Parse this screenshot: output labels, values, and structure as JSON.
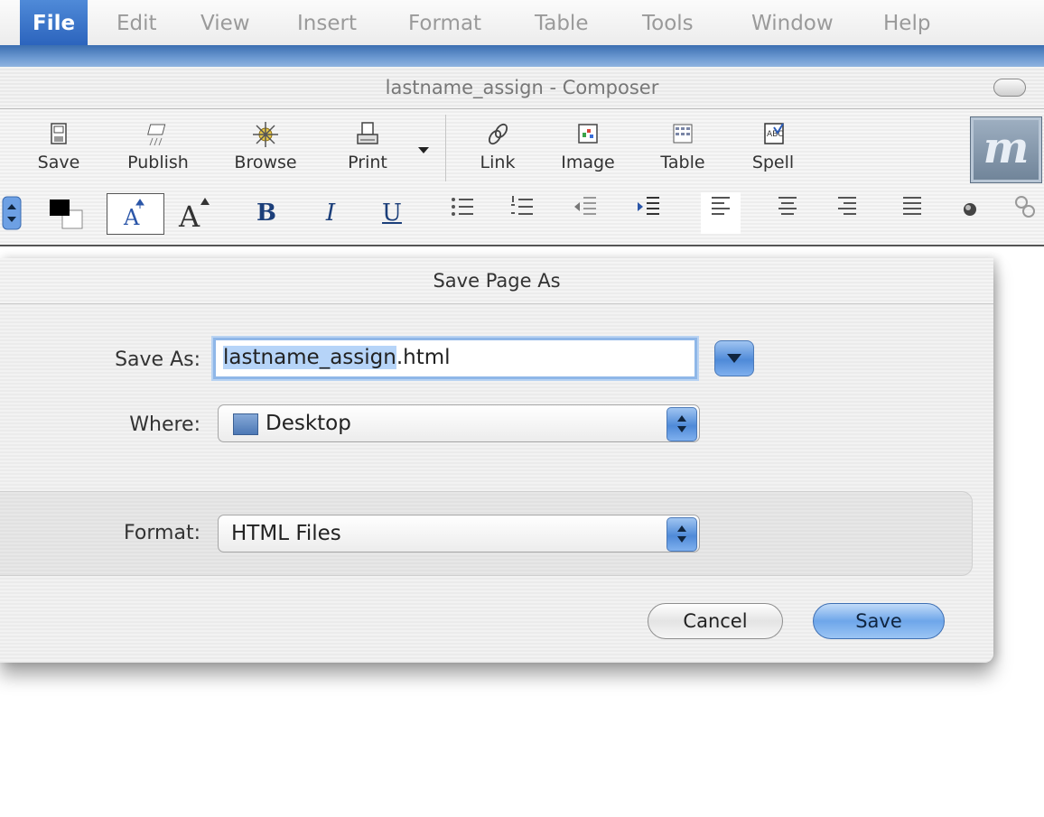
{
  "menubar": {
    "items": [
      "File",
      "Edit",
      "View",
      "Insert",
      "Format",
      "Table",
      "Tools",
      "Window",
      "Help"
    ]
  },
  "window": {
    "title": "lastname_assign - Composer"
  },
  "toolbar": {
    "buttons": [
      {
        "label": "Save",
        "icon": "save-icon"
      },
      {
        "label": "Publish",
        "icon": "publish-icon"
      },
      {
        "label": "Browse",
        "icon": "browse-icon"
      },
      {
        "label": "Print",
        "icon": "print-icon"
      },
      {
        "label": "Link",
        "icon": "link-icon"
      },
      {
        "label": "Image",
        "icon": "image-icon"
      },
      {
        "label": "Table",
        "icon": "table-icon"
      },
      {
        "label": "Spell",
        "icon": "spell-icon"
      }
    ],
    "logo_letter": "m"
  },
  "formatbar": {
    "bold": "B",
    "italic": "I",
    "underline": "U"
  },
  "dialog": {
    "title": "Save Page As",
    "save_as_label": "Save As:",
    "filename_selected": "lastname_assign",
    "filename_ext": ".html",
    "where_label": "Where:",
    "where_value": "Desktop",
    "format_label": "Format:",
    "format_value": "HTML Files",
    "cancel_label": "Cancel",
    "save_label": "Save"
  },
  "colors": {
    "accent": "#4f8ad8",
    "menu_active": "#2c64bd"
  }
}
